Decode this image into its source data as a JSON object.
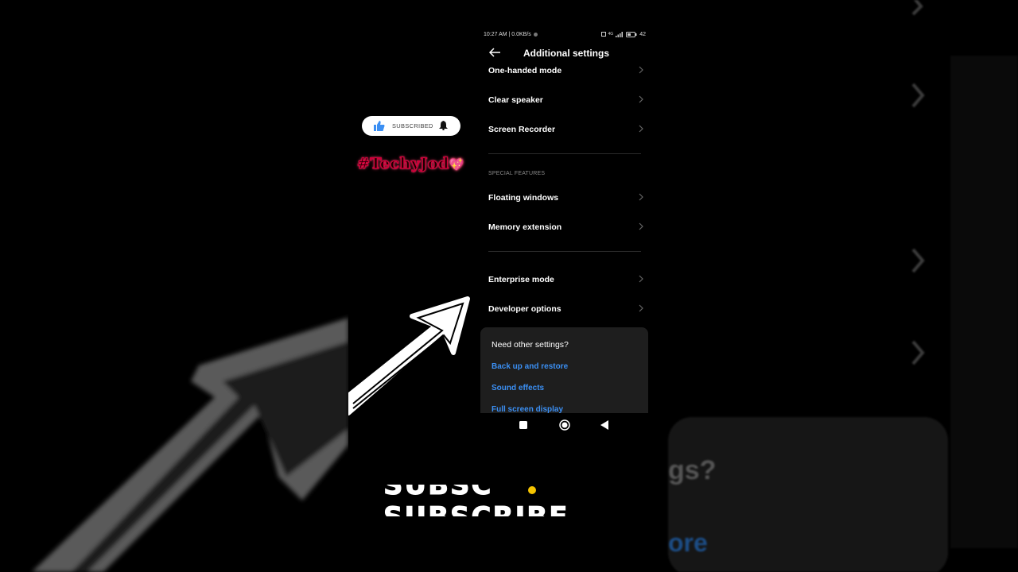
{
  "status_bar": {
    "time_speed": "10:27 AM | 0.0KB/s",
    "network": "4G",
    "battery": "42"
  },
  "header": {
    "title": "Additional settings",
    "back_icon": "back-arrow-icon"
  },
  "items_group1": [
    {
      "label": "One-handed mode"
    },
    {
      "label": "Clear speaker"
    },
    {
      "label": "Screen Recorder"
    }
  ],
  "section_special": {
    "title": "SPECIAL FEATURES",
    "items": [
      {
        "label": "Floating windows"
      },
      {
        "label": "Memory extension"
      }
    ]
  },
  "items_group3": [
    {
      "label": "Enterprise mode"
    },
    {
      "label": "Developer options"
    }
  ],
  "other_settings": {
    "title": "Need other settings?",
    "links": [
      {
        "label": "Back up and restore"
      },
      {
        "label": "Sound effects"
      },
      {
        "label": "Full screen display"
      }
    ]
  },
  "overlay": {
    "subscribed_label": "SUBSCRIBED",
    "hashtag": "#TechyJod",
    "hashtag_emoji": "💖",
    "subscribe_line1": "SUBSC",
    "subscribe_line2": "SUBSCRIBE"
  },
  "background_ghost": {
    "word_fragment": "gs?",
    "link_fragment": "ore"
  },
  "colors": {
    "background": "#000000",
    "link_blue": "#3b8ff3",
    "card_bg": "#1e1e1e",
    "hashtag_red": "#d0003a"
  }
}
